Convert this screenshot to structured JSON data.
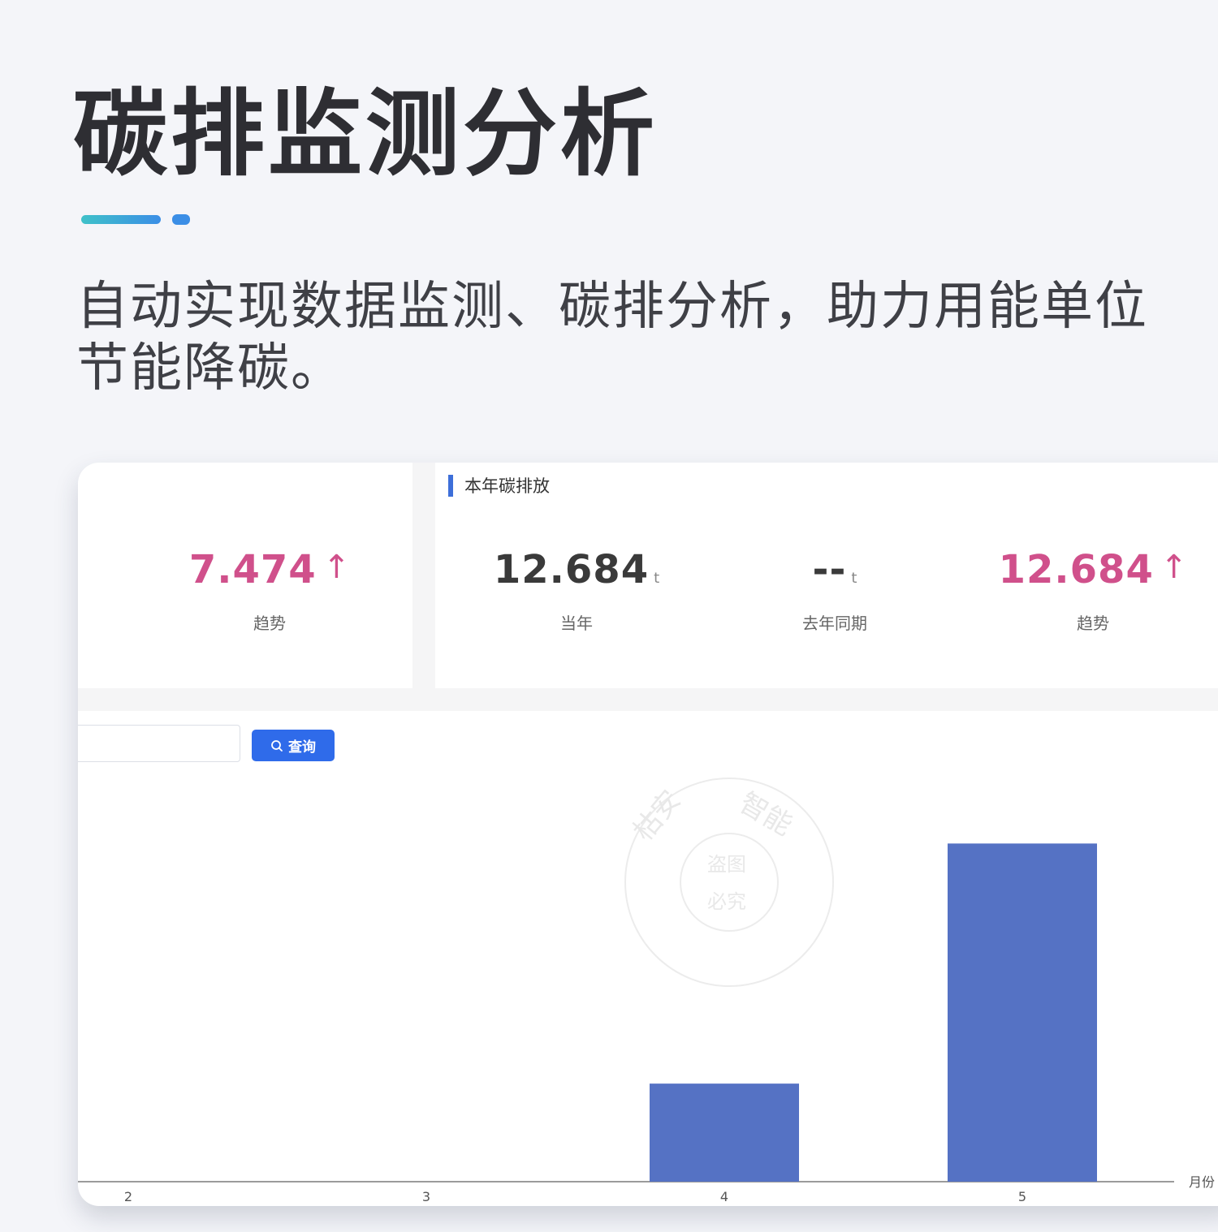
{
  "hero": {
    "title": "碳排监测分析",
    "subtitle": "自动实现数据监测、碳排分析，助力用能单位节能降碳。"
  },
  "colors": {
    "accent_pink": "#d0508b",
    "bar_blue": "#5572c4",
    "button_blue": "#2f6bea",
    "section_marker": "#3d6fd9"
  },
  "left_panel": {
    "stat": {
      "value": "7.474",
      "arrow": "↑",
      "label": "趋势"
    }
  },
  "annual_panel": {
    "title": "本年碳排放",
    "stats": [
      {
        "value": "12.684",
        "unit": "t",
        "label": "当年"
      },
      {
        "value": "--",
        "unit": "t",
        "label": "去年同期"
      },
      {
        "value": "12.684",
        "arrow": "↑",
        "label": "趋势"
      }
    ]
  },
  "filter": {
    "query_label": "查询",
    "search_icon": "search-icon"
  },
  "watermark": {
    "outer_text": "枯安智能",
    "inner_line1": "盗图",
    "inner_line2": "必究"
  },
  "chart_data": {
    "type": "bar",
    "categories": [
      "2",
      "3",
      "4",
      "5"
    ],
    "values": [
      0,
      0,
      2.9,
      10.0
    ],
    "xlabel": "月份",
    "ylabel": "",
    "ylim": [
      0,
      12
    ],
    "grid": false
  }
}
